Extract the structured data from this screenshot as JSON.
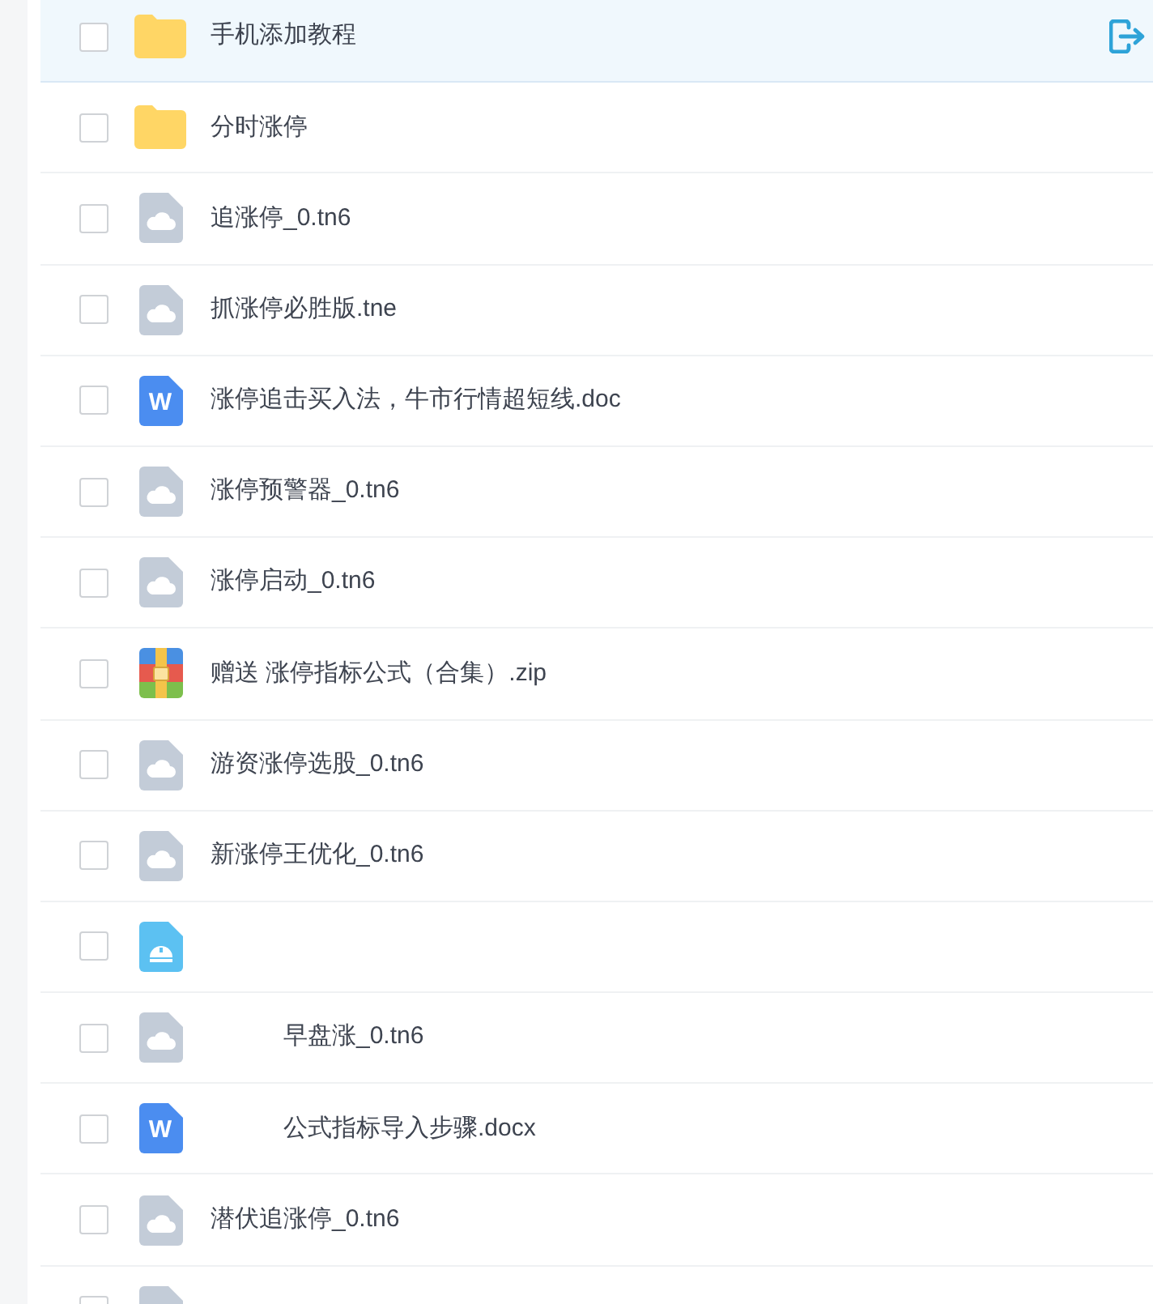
{
  "files": [
    {
      "kind": "folder",
      "name": "手机添加教程",
      "selected": true,
      "checked": false,
      "masked_start": false
    },
    {
      "kind": "folder",
      "name": "分时涨停",
      "selected": false,
      "checked": false,
      "masked_start": false
    },
    {
      "kind": "cloud",
      "name": "追涨停_0.tn6",
      "selected": false,
      "checked": false,
      "masked_start": false
    },
    {
      "kind": "cloud",
      "name": "抓涨停必胜版.tne",
      "selected": false,
      "checked": false,
      "masked_start": false
    },
    {
      "kind": "word",
      "icon_letter": "W",
      "name": "涨停追击买入法，牛市行情超短线.doc",
      "selected": false,
      "checked": false,
      "masked_start": false
    },
    {
      "kind": "cloud",
      "name": "涨停预警器_0.tn6",
      "selected": false,
      "checked": false,
      "masked_start": false
    },
    {
      "kind": "cloud",
      "name": "涨停启动_0.tn6",
      "selected": false,
      "checked": false,
      "masked_start": false
    },
    {
      "kind": "archive",
      "name": "赠送 涨停指标公式（合集）.zip",
      "selected": false,
      "checked": false,
      "masked_start": false
    },
    {
      "kind": "cloud",
      "name": "游资涨停选股_0.tn6",
      "selected": false,
      "checked": false,
      "masked_start": false
    },
    {
      "kind": "cloud",
      "name": "新涨停王优化_0.tn6",
      "selected": false,
      "checked": false,
      "masked_start": false
    },
    {
      "kind": "setup",
      "selected": false,
      "checked": false
    },
    {
      "kind": "cloud",
      "name": "早盘涨_0.tn6",
      "selected": false,
      "checked": false,
      "masked_start": true
    },
    {
      "kind": "word",
      "icon_letter": "W",
      "name": "公式指标导入步骤.docx",
      "selected": false,
      "checked": false,
      "masked_start": true
    },
    {
      "kind": "cloud",
      "name": "潜伏追涨停_0.tn6",
      "selected": false,
      "checked": false,
      "masked_start": false
    },
    {
      "kind": "cloud",
      "selected": false,
      "checked": false
    }
  ]
}
